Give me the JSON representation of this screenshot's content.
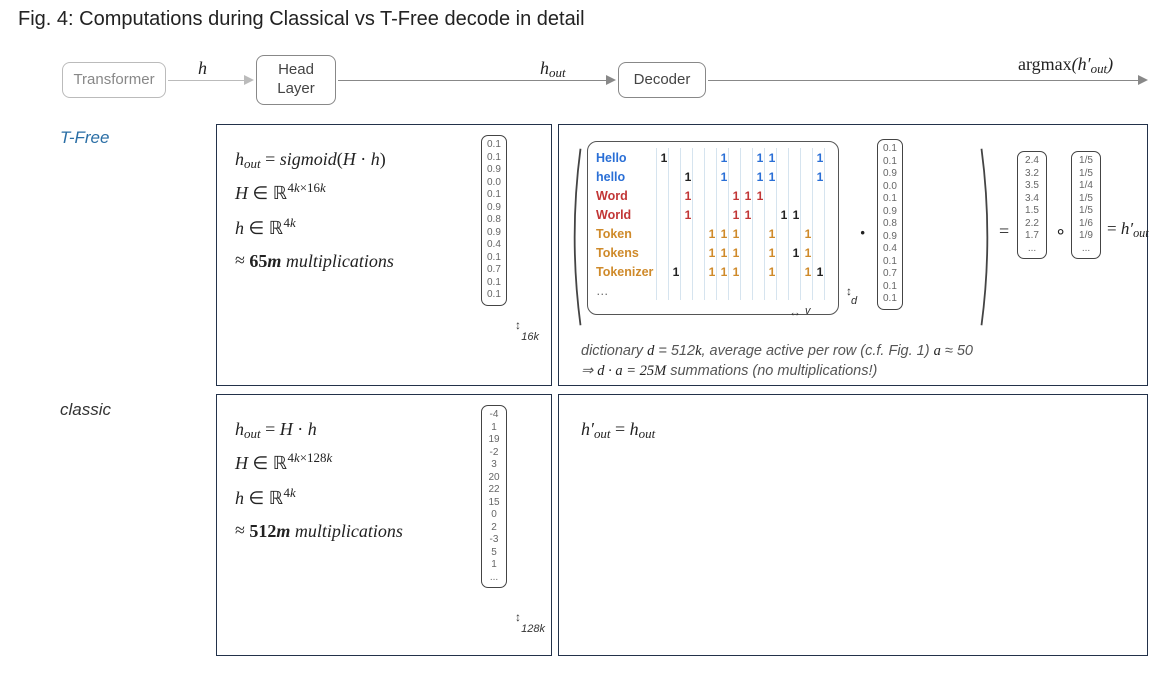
{
  "title": "Fig. 4: Computations during Classical vs T-Free decode in detail",
  "flow": {
    "node1": "Transformer",
    "arrow1_label": "h",
    "node2": "Head\nLayer",
    "arrow2_label": "hₒᵤₜ",
    "node3": "Decoder",
    "arrow3_label": "argmax(h′ₒᵤₜ)"
  },
  "rows": {
    "tfree_label": "T-Free",
    "classic_label": "classic"
  },
  "tfree_head": {
    "line1_html": "<span class='it'>h</span><sub>out</sub> = <span class='it'>sigmoid</span>(<span class='it'>H</span> · <span class='it'>h</span>)",
    "line2_html": "<span class='it'>H</span> ∈ <span class='bb'>ℝ</span><sup>4<span class='it'>k</span>×16<span class='it'>k</span></sup>",
    "line3_html": "<span class='it'>h</span> ∈ <span class='bb'>ℝ</span><sup>4<span class='it'>k</span></sup>",
    "line4_html": "<span class='approx'>≈</span> <span class='bold'>65<span class='it'>m</span></span> <span class='it'>multiplications</span>",
    "vector": [
      "0.1",
      "0.1",
      "0.9",
      "0.0",
      "0.1",
      "0.9",
      "0.8",
      "0.9",
      "0.4",
      "0.1",
      "0.7",
      "0.1",
      "0.1"
    ],
    "vector_size": "16k"
  },
  "tfree_decoder": {
    "tokens": [
      {
        "name": "Hello",
        "color": "blue",
        "cells": {
          "0": "black",
          "5": "blue",
          "8": "blue",
          "9": "blue",
          "13": "blue"
        }
      },
      {
        "name": "hello",
        "color": "blue",
        "cells": {
          "2": "black",
          "5": "blue",
          "8": "blue",
          "9": "blue",
          "13": "blue"
        }
      },
      {
        "name": "Word",
        "color": "red",
        "cells": {
          "2": "red",
          "6": "red",
          "7": "red",
          "8": "red"
        }
      },
      {
        "name": "World",
        "color": "red",
        "cells": {
          "2": "red",
          "6": "red",
          "7": "red",
          "10": "black",
          "11": "black"
        }
      },
      {
        "name": "Token",
        "color": "orange",
        "cells": {
          "4": "orange",
          "5": "orange",
          "6": "orange",
          "9": "orange",
          "12": "orange"
        }
      },
      {
        "name": "Tokens",
        "color": "orange",
        "cells": {
          "4": "orange",
          "5": "orange",
          "6": "orange",
          "9": "orange",
          "11": "black",
          "12": "orange"
        }
      },
      {
        "name": "Tokenizer",
        "color": "orange",
        "cells": {
          "1": "black",
          "4": "orange",
          "5": "orange",
          "6": "orange",
          "9": "orange",
          "12": "orange",
          "13": "black"
        }
      },
      {
        "name": "…",
        "color": "grey",
        "cells": {}
      }
    ],
    "matrix_cols": 14,
    "matrix_v_label": "v",
    "matrix_d_label": "d",
    "mult_vector": [
      "0.1",
      "0.1",
      "0.9",
      "0.0",
      "0.1",
      "0.9",
      "0.8",
      "0.9",
      "0.4",
      "0.1",
      "0.7",
      "0.1",
      "0.1"
    ],
    "result_vector": [
      "2.4",
      "3.2",
      "3.5",
      "3.4",
      "1.5",
      "2.2",
      "1.7",
      "..."
    ],
    "norm_vector": [
      "1/5",
      "1/5",
      "1/4",
      "1/5",
      "1/5",
      "1/6",
      "1/9",
      "..."
    ],
    "rhs_label_html": "= <span class='it'>h′</span><sub>out</sub>",
    "note_line1_html": "dictionary <span class='math-inline'>d</span> = 512<span class='math-inline'>k</span>, average active per row (c.f. Fig. 1) <span class='math-inline'>a</span> ≈ 50",
    "note_line2_html": "⇒ <span class='math-inline'>d · a = 25M</span> summations (no multiplications!)"
  },
  "classic_head": {
    "line1_html": "<span class='it'>h</span><sub>out</sub> = <span class='it'>H</span> · <span class='it'>h</span>",
    "line2_html": "<span class='it'>H</span> ∈ <span class='bb'>ℝ</span><sup>4<span class='it'>k</span>×128<span class='it'>k</span></sup>",
    "line3_html": "<span class='it'>h</span> ∈ <span class='bb'>ℝ</span><sup>4<span class='it'>k</span></sup>",
    "line4_html": "<span class='approx'>≈</span> <span class='bold'>512<span class='it'>m</span></span> <span class='it'>multiplications</span>",
    "vector": [
      "-4",
      "1",
      "19",
      "-2",
      "3",
      "20",
      "22",
      "15",
      "0",
      "2",
      "-3",
      "5",
      "1",
      "..."
    ],
    "vector_size": "128k"
  },
  "classic_decoder": {
    "line1_html": "<span class='it'>h′</span><sub>out</sub> = <span class='it'>h</span><sub>out</sub>"
  },
  "symbols": {
    "dot": "·",
    "equals": "=",
    "circ": "∘"
  }
}
